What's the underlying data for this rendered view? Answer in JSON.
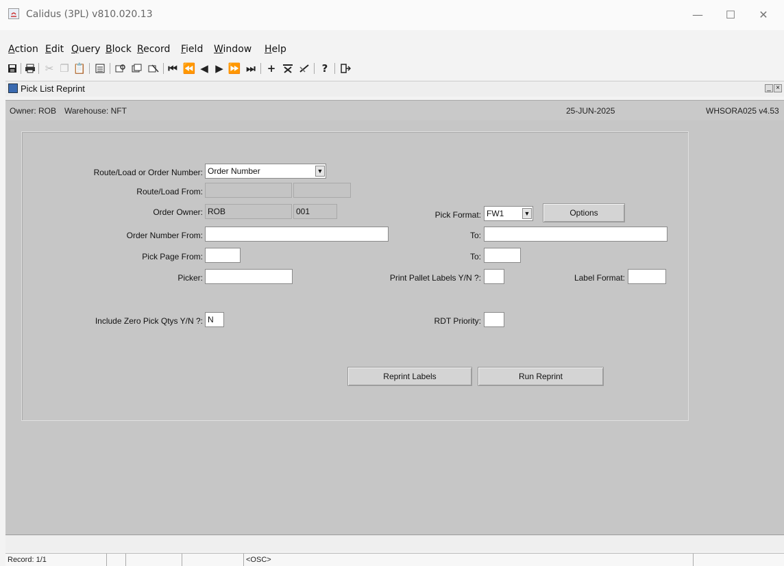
{
  "window": {
    "title": "Calidus (3PL) v810.020.13",
    "controls": {
      "minimize": "—",
      "maximize": "☐",
      "close": "✕"
    }
  },
  "menu": {
    "items": [
      {
        "ul": "A",
        "rest": "ction"
      },
      {
        "ul": "E",
        "rest": "dit"
      },
      {
        "ul": "Q",
        "rest": "uery"
      },
      {
        "ul": "B",
        "rest": "lock"
      },
      {
        "ul": "R",
        "rest": "ecord"
      },
      {
        "ul": "F",
        "rest": "ield"
      },
      {
        "ul": "W",
        "rest": "indow"
      },
      {
        "ul": "H",
        "rest": "elp"
      }
    ]
  },
  "toolbar": {
    "icons": [
      "save-icon",
      "print-icon",
      "cut-icon",
      "copy-icon",
      "paste-icon",
      "list-icon",
      "enter-query-icon",
      "execute-query-icon",
      "cancel-query-icon",
      "first-record-icon",
      "previous-set-icon",
      "previous-record-icon",
      "next-record-icon",
      "next-set-icon",
      "last-record-icon",
      "insert-record-icon",
      "delete-record-icon",
      "clear-record-icon",
      "help-icon",
      "exit-icon"
    ]
  },
  "form": {
    "title": "Pick List Reprint",
    "header": {
      "owner": "Owner: ROB",
      "warehouse": "Warehouse: NFT",
      "date": "25-JUN-2025",
      "module": "WHSORA025 v4.53"
    },
    "labels": {
      "route_or_order": "Route/Load or Order Number:",
      "route_from": "Route/Load From:",
      "order_owner": "Order Owner:",
      "order_number_from": "Order Number From:",
      "pick_page_from": "Pick Page From:",
      "picker": "Picker:",
      "include_zero": "Include Zero Pick Qtys Y/N ?:",
      "pick_format": "Pick Format:",
      "to": "To:",
      "print_pallet": "Print Pallet Labels Y/N ?:",
      "label_format": "Label Format:",
      "rdt_priority": "RDT Priority:"
    },
    "values": {
      "route_or_order": "Order Number",
      "route_from_1": "",
      "route_from_2": "",
      "order_owner": "ROB",
      "order_owner_code": "001",
      "order_number_from": "",
      "order_number_to": "",
      "pick_page_from": "",
      "pick_page_to": "",
      "picker": "",
      "include_zero": "N",
      "pick_format": "FW1",
      "print_pallet": "",
      "label_format": "",
      "rdt_priority": ""
    },
    "buttons": {
      "options": "Options",
      "reprint_labels": "Reprint Labels",
      "run_reprint": "Run Reprint"
    }
  },
  "status": {
    "record": "Record: 1/1",
    "cell2": "",
    "cell3": "",
    "cell4": "",
    "osc": "<OSC>"
  }
}
